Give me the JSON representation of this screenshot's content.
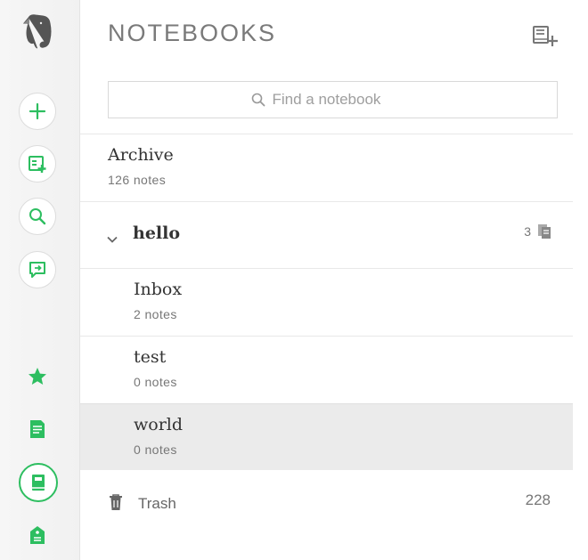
{
  "sidebar": {
    "logo": "evernote-elephant-icon",
    "buttons": [
      {
        "name": "new-note-button",
        "icon": "plus-icon"
      },
      {
        "name": "new-chat-button",
        "icon": "note-plus-icon"
      },
      {
        "name": "search-button",
        "icon": "search-icon"
      },
      {
        "name": "work-chat-button",
        "icon": "chat-icon"
      }
    ],
    "nav": [
      {
        "name": "shortcuts",
        "icon": "star-icon"
      },
      {
        "name": "notes",
        "icon": "note-icon"
      },
      {
        "name": "notebooks",
        "icon": "notebook-icon",
        "active": true
      },
      {
        "name": "tags",
        "icon": "tag-icon"
      }
    ],
    "accent": "#2dbe60"
  },
  "header": {
    "title": "NOTEBOOKS"
  },
  "search": {
    "placeholder": "Find a notebook"
  },
  "notebooks": [
    {
      "name": "Archive",
      "count": "126 notes"
    },
    {
      "name": "hello",
      "stack": true,
      "stack_count": "3"
    },
    {
      "name": "Inbox",
      "count": "2 notes"
    },
    {
      "name": "test",
      "count": "0 notes"
    },
    {
      "name": "world",
      "count": "0 notes",
      "selected": true
    }
  ],
  "trash": {
    "label": "Trash",
    "count": "228"
  }
}
